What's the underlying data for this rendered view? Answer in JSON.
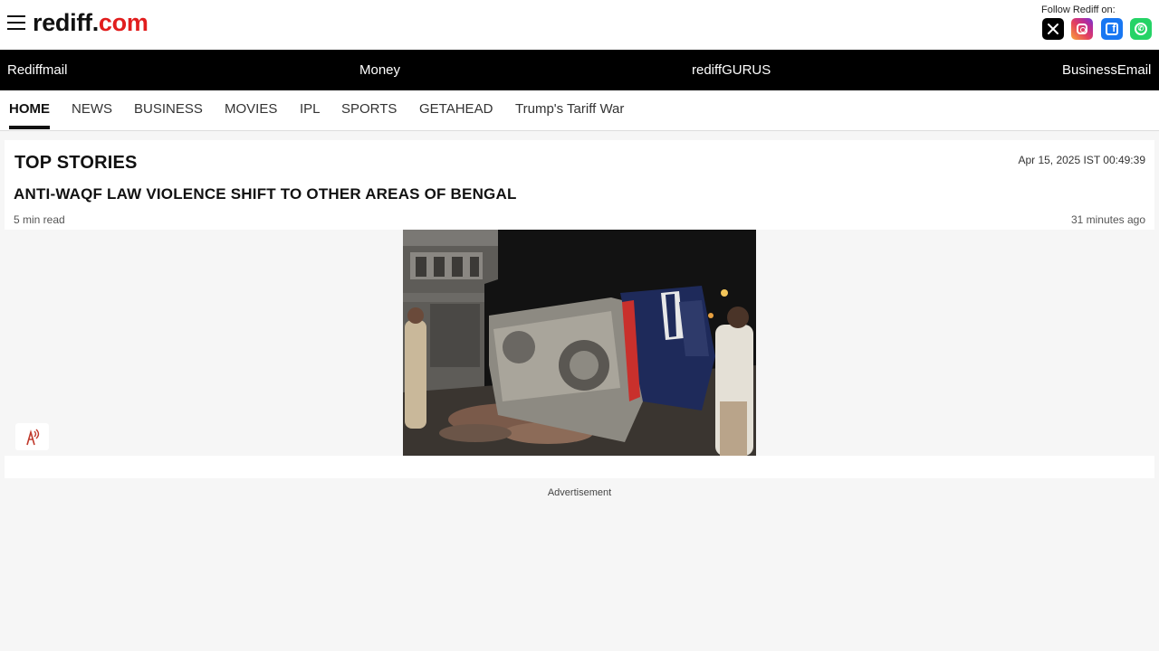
{
  "header": {
    "logo_part1": "rediff.",
    "logo_part2": "com",
    "follow_label": "Follow Rediff on:",
    "social": [
      "x-icon",
      "instagram-icon",
      "facebook-icon",
      "whatsapp-icon"
    ]
  },
  "blackbar": {
    "links": [
      "Rediffmail",
      "Money",
      "rediffGURUS",
      "BusinessEmail"
    ]
  },
  "tabs": {
    "items": [
      "HOME",
      "NEWS",
      "BUSINESS",
      "MOVIES",
      "IPL",
      "SPORTS",
      "GETAHEAD",
      "Trump's Tariff War"
    ],
    "active": "HOME"
  },
  "top_stories": {
    "title": "TOP STORIES",
    "datetime": "Apr 15, 2025 IST 00:49:39",
    "headline": "ANTI-WAQF LAW VIOLENCE SHIFT TO OTHER AREAS OF BENGAL",
    "read_time": "5 min read",
    "time_ago": "31 minutes ago"
  },
  "ad": {
    "label": "Advertisement"
  },
  "colors": {
    "brand_red": "#e11d1d",
    "black_bar": "#000000",
    "page_bg": "#f6f6f6"
  }
}
